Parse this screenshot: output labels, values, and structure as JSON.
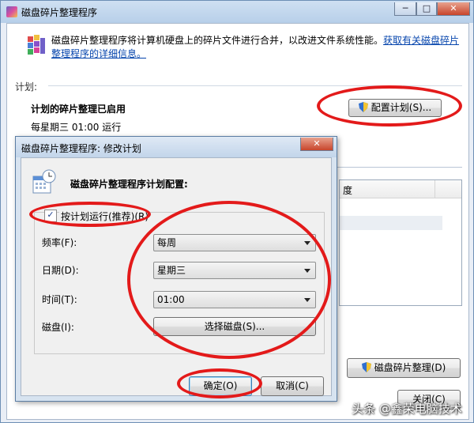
{
  "main_window": {
    "title": "磁盘碎片整理程序",
    "caption_min": "─",
    "caption_max": "□",
    "caption_close": "✕",
    "description": "磁盘碎片整理程序将计算机硬盘上的碎片文件进行合并，以改进文件系统性能。",
    "help_link": "获取有关磁盘碎片整理程序的详细信息。",
    "schedule_section_label": "计划:",
    "schedule_status": "计划的碎片整理已启用",
    "schedule_detail": "每星期三 01:00 运行",
    "configure_schedule_button": "配置计划(S)...",
    "list_column_progress": "度",
    "defrag_button": "磁盘碎片整理(D)",
    "close_button": "关闭(C)"
  },
  "dialog": {
    "title": "磁盘碎片整理程序: 修改计划",
    "close": "✕",
    "heading": "磁盘碎片整理程序计划配置:",
    "run_on_schedule_checkbox": "按计划运行(推荐)(R)",
    "run_on_schedule_checked": true,
    "frequency_label": "频率(F):",
    "frequency_value": "每周",
    "day_label": "日期(D):",
    "day_value": "星期三",
    "time_label": "时间(T):",
    "time_value": "01:00",
    "disks_label": "磁盘(I):",
    "select_disks_button": "选择磁盘(S)...",
    "ok_button": "确定(O)",
    "cancel_button": "取消(C)"
  },
  "watermark": "头条 @鑫荣电脑技术",
  "colors": {
    "annotation_ring": "#e31a1a",
    "link": "#0645ad",
    "title_bar": "#c2d5ea"
  }
}
